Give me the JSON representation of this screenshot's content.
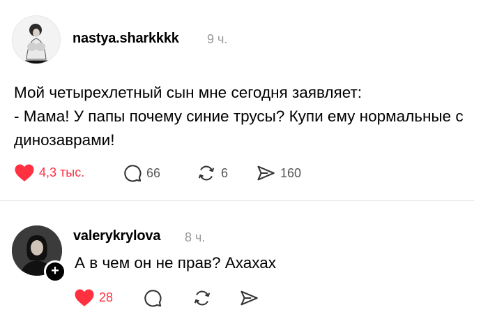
{
  "post": {
    "author": "nastya.sharkkkk",
    "time": "9 ч.",
    "text": "Мой четырехлетный сын мне сегодня заявляет:\n- Мама! У папы почему синие трусы? Купи ему нормальные с динозаврами!",
    "actions": {
      "likes": "4,3 тыс.",
      "comments": "66",
      "reposts": "6",
      "shares": "160"
    },
    "avatar_icon": "user-avatar-photo",
    "like_color": "#ff3040"
  },
  "reply": {
    "author": "valerykrylova",
    "time": "8 ч.",
    "text": "А в чем он не прав? Ахахах",
    "follow_icon": "+",
    "actions": {
      "likes": "28"
    },
    "avatar_icon": "user-avatar-photo",
    "like_color": "#ff3040"
  },
  "icons": {
    "like": "heart-filled-icon",
    "comment": "speech-bubble-icon",
    "repost": "repost-arrows-icon",
    "share": "paper-plane-icon"
  }
}
